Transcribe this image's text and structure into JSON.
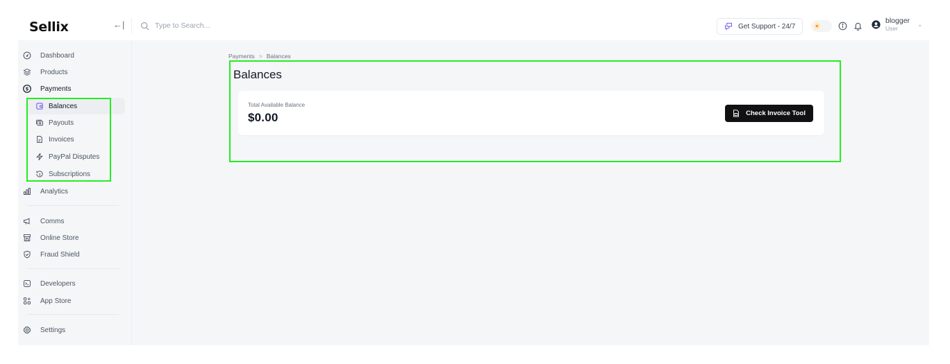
{
  "header": {
    "logo": "Sellix",
    "collapse_icon": "arrow-left-bar-icon",
    "search": {
      "placeholder": "Type to Search...",
      "value": ""
    },
    "support_label": "Get Support - 24/7",
    "user": {
      "name": "blogger",
      "role": "User"
    }
  },
  "sidebar": {
    "items": [
      {
        "label": "Dashboard",
        "icon": "dashboard-icon"
      },
      {
        "label": "Products",
        "icon": "layers-icon"
      },
      {
        "label": "Payments",
        "icon": "dollar-circle-icon"
      },
      {
        "label": "Balances",
        "icon": "wallet-icon",
        "active": true,
        "sub": true
      },
      {
        "label": "Payouts",
        "icon": "cash-icon",
        "sub": true
      },
      {
        "label": "Invoices",
        "icon": "file-icon",
        "sub": true
      },
      {
        "label": "PayPal Disputes",
        "icon": "bolt-icon",
        "sub": true
      },
      {
        "label": "Subscriptions",
        "icon": "recurring-dollar-icon",
        "sub": true
      },
      {
        "label": "Analytics",
        "icon": "bar-chart-icon"
      },
      {
        "label": "Comms",
        "icon": "megaphone-icon"
      },
      {
        "label": "Online Store",
        "icon": "store-icon"
      },
      {
        "label": "Fraud Shield",
        "icon": "shield-check-icon"
      },
      {
        "label": "Developers",
        "icon": "terminal-icon"
      },
      {
        "label": "App Store",
        "icon": "apps-add-icon"
      },
      {
        "label": "Settings",
        "icon": "gear-icon"
      }
    ]
  },
  "main": {
    "breadcrumb": [
      "Payments",
      "Balances"
    ],
    "breadcrumb_separator": ">",
    "title": "Balances",
    "balance_card": {
      "label": "Total Available Balance",
      "amount": "$0.00",
      "button_label": "Check Invoice Tool"
    }
  },
  "colors": {
    "accent": "#7c5cf0",
    "button_bg": "#111113",
    "app_bg": "#f5f6f8",
    "highlight": "#22ee22"
  }
}
